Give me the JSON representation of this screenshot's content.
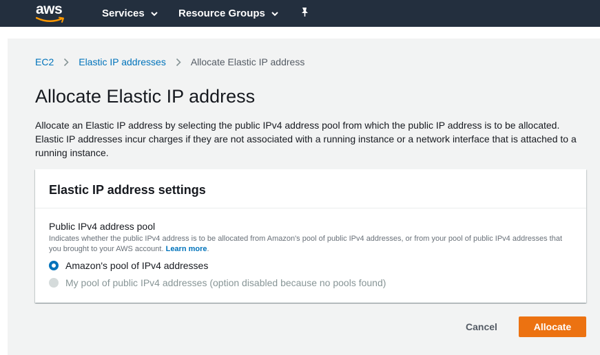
{
  "topnav": {
    "logo_text": "aws",
    "services_label": "Services",
    "resource_groups_label": "Resource Groups",
    "pin_icon": "pin-icon",
    "caret_icon": "chevron-down-icon"
  },
  "breadcrumb": {
    "items": [
      "EC2",
      "Elastic IP addresses"
    ],
    "current": "Allocate Elastic IP address"
  },
  "page": {
    "title": "Allocate Elastic IP address",
    "description": "Allocate an Elastic IP address by selecting the public IPv4 address pool from which the public IP address is to be allocated. Elastic IP addresses incur charges if they are not associated with a running instance or a network interface that is attached to a running instance."
  },
  "settings": {
    "title": "Elastic IP address settings",
    "pool_label": "Public IPv4 address pool",
    "pool_description": "Indicates whether the public IPv4 address is to be allocated from Amazon's pool of public IPv4 addresses, or from your pool of public IPv4 addresses that you brought to your AWS account.",
    "learn_more": "Learn more",
    "options": [
      {
        "label": "Amazon's pool of IPv4 addresses",
        "selected": true,
        "disabled": false
      },
      {
        "label": "My pool of public IPv4 addresses (option disabled because no pools found)",
        "selected": false,
        "disabled": true
      }
    ]
  },
  "actions": {
    "cancel_label": "Cancel",
    "allocate_label": "Allocate"
  },
  "colors": {
    "nav_bg": "#232f3e",
    "link": "#0073bb",
    "primary_button": "#ec7211",
    "logo_smile": "#ff9900"
  }
}
